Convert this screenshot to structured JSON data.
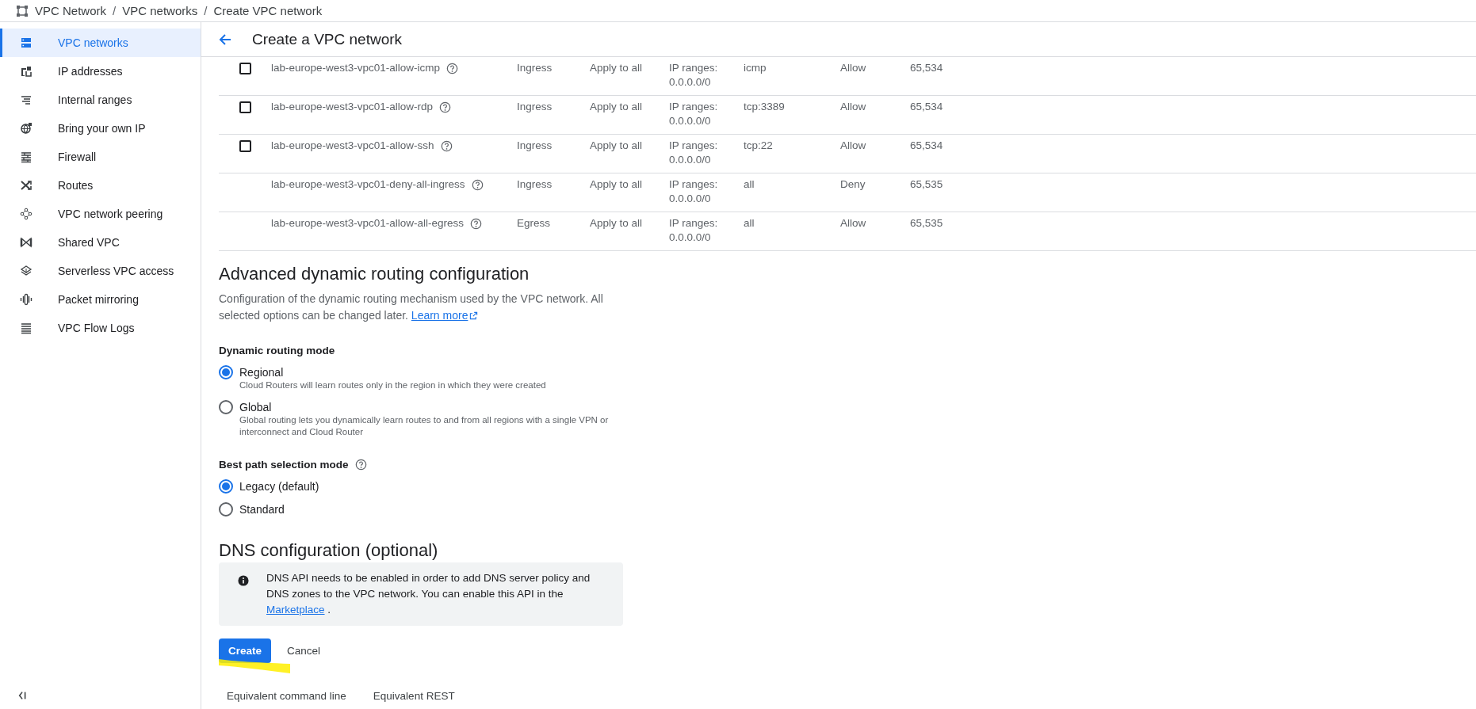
{
  "breadcrumb": [
    {
      "kind": "link",
      "text": "VPC Network"
    },
    {
      "kind": "separator",
      "text": "/"
    },
    {
      "kind": "link",
      "text": "VPC networks"
    },
    {
      "kind": "separator",
      "text": "/"
    },
    {
      "kind": "current",
      "text": "Create VPC network"
    }
  ],
  "sidebar": {
    "items": [
      {
        "label": "VPC networks",
        "selected": true
      },
      {
        "label": "IP addresses",
        "selected": false
      },
      {
        "label": "Internal ranges",
        "selected": false
      },
      {
        "label": "Bring your own IP",
        "selected": false
      },
      {
        "label": "Firewall",
        "selected": false
      },
      {
        "label": "Routes",
        "selected": false
      },
      {
        "label": "VPC network peering",
        "selected": false
      },
      {
        "label": "Shared VPC",
        "selected": false
      },
      {
        "label": "Serverless VPC access",
        "selected": false
      },
      {
        "label": "Packet mirroring",
        "selected": false
      },
      {
        "label": "VPC Flow Logs",
        "selected": false
      }
    ]
  },
  "page_title": "Create a VPC network",
  "firewall_rules": [
    {
      "kind": "selectable",
      "checked": false,
      "name": "lab-europe-west3-vpc01-allow-icmp",
      "direction": "Ingress",
      "targets": "Apply to all",
      "filters": [
        "IP ranges:",
        "0.0.0.0/0"
      ],
      "protocols": "icmp",
      "action": "Allow",
      "priority": "65,534"
    },
    {
      "kind": "selectable",
      "checked": false,
      "name": "lab-europe-west3-vpc01-allow-rdp",
      "direction": "Ingress",
      "targets": "Apply to all",
      "filters": [
        "IP ranges:",
        "0.0.0.0/0"
      ],
      "protocols": "tcp:3389",
      "action": "Allow",
      "priority": "65,534"
    },
    {
      "kind": "selectable",
      "checked": false,
      "name": "lab-europe-west3-vpc01-allow-ssh",
      "direction": "Ingress",
      "targets": "Apply to all",
      "filters": [
        "IP ranges:",
        "0.0.0.0/0"
      ],
      "protocols": "tcp:22",
      "action": "Allow",
      "priority": "65,534"
    },
    {
      "kind": "fixed",
      "name": "lab-europe-west3-vpc01-deny-all-ingress",
      "direction": "Ingress",
      "targets": "Apply to all",
      "filters": [
        "IP ranges:",
        "0.0.0.0/0"
      ],
      "protocols": "all",
      "action": "Deny",
      "priority": "65,535"
    },
    {
      "kind": "fixed",
      "name": "lab-europe-west3-vpc01-allow-all-egress",
      "direction": "Egress",
      "targets": "Apply to all",
      "filters": [
        "IP ranges:",
        "0.0.0.0/0"
      ],
      "protocols": "all",
      "action": "Allow",
      "priority": "65,535"
    }
  ],
  "routing": {
    "heading": "Advanced dynamic routing configuration",
    "description": "Configuration of the dynamic routing mechanism used by the VPC network. All selected options can be changed later.",
    "link": "Learn more",
    "groups": [
      {
        "label": "Dynamic routing mode",
        "help": false,
        "options": [
          {
            "label": "Regional",
            "description": "Cloud Routers will learn routes only in the region in which they were created",
            "selected": true
          },
          {
            "label": "Global",
            "description": "Global routing lets you dynamically learn routes to and from all regions with a single VPN or interconnect and Cloud Router",
            "selected": false
          }
        ]
      },
      {
        "label": "Best path selection mode",
        "help": true,
        "options": [
          {
            "label": "Legacy (default)",
            "selected": true
          },
          {
            "label": "Standard",
            "selected": false
          }
        ]
      }
    ]
  },
  "dns": {
    "heading": "DNS configuration (optional)",
    "notice": "DNS API needs to be enabled in order to add DNS server policy and DNS zones to the VPC network. You can enable this API in the",
    "link": "Marketplace",
    "notice_end": "."
  },
  "buttons": [
    {
      "label": "Create",
      "kind": "primary"
    },
    {
      "label": "Cancel",
      "kind": "text"
    }
  ],
  "equivalents": [
    "Equivalent command line",
    "Equivalent REST"
  ]
}
